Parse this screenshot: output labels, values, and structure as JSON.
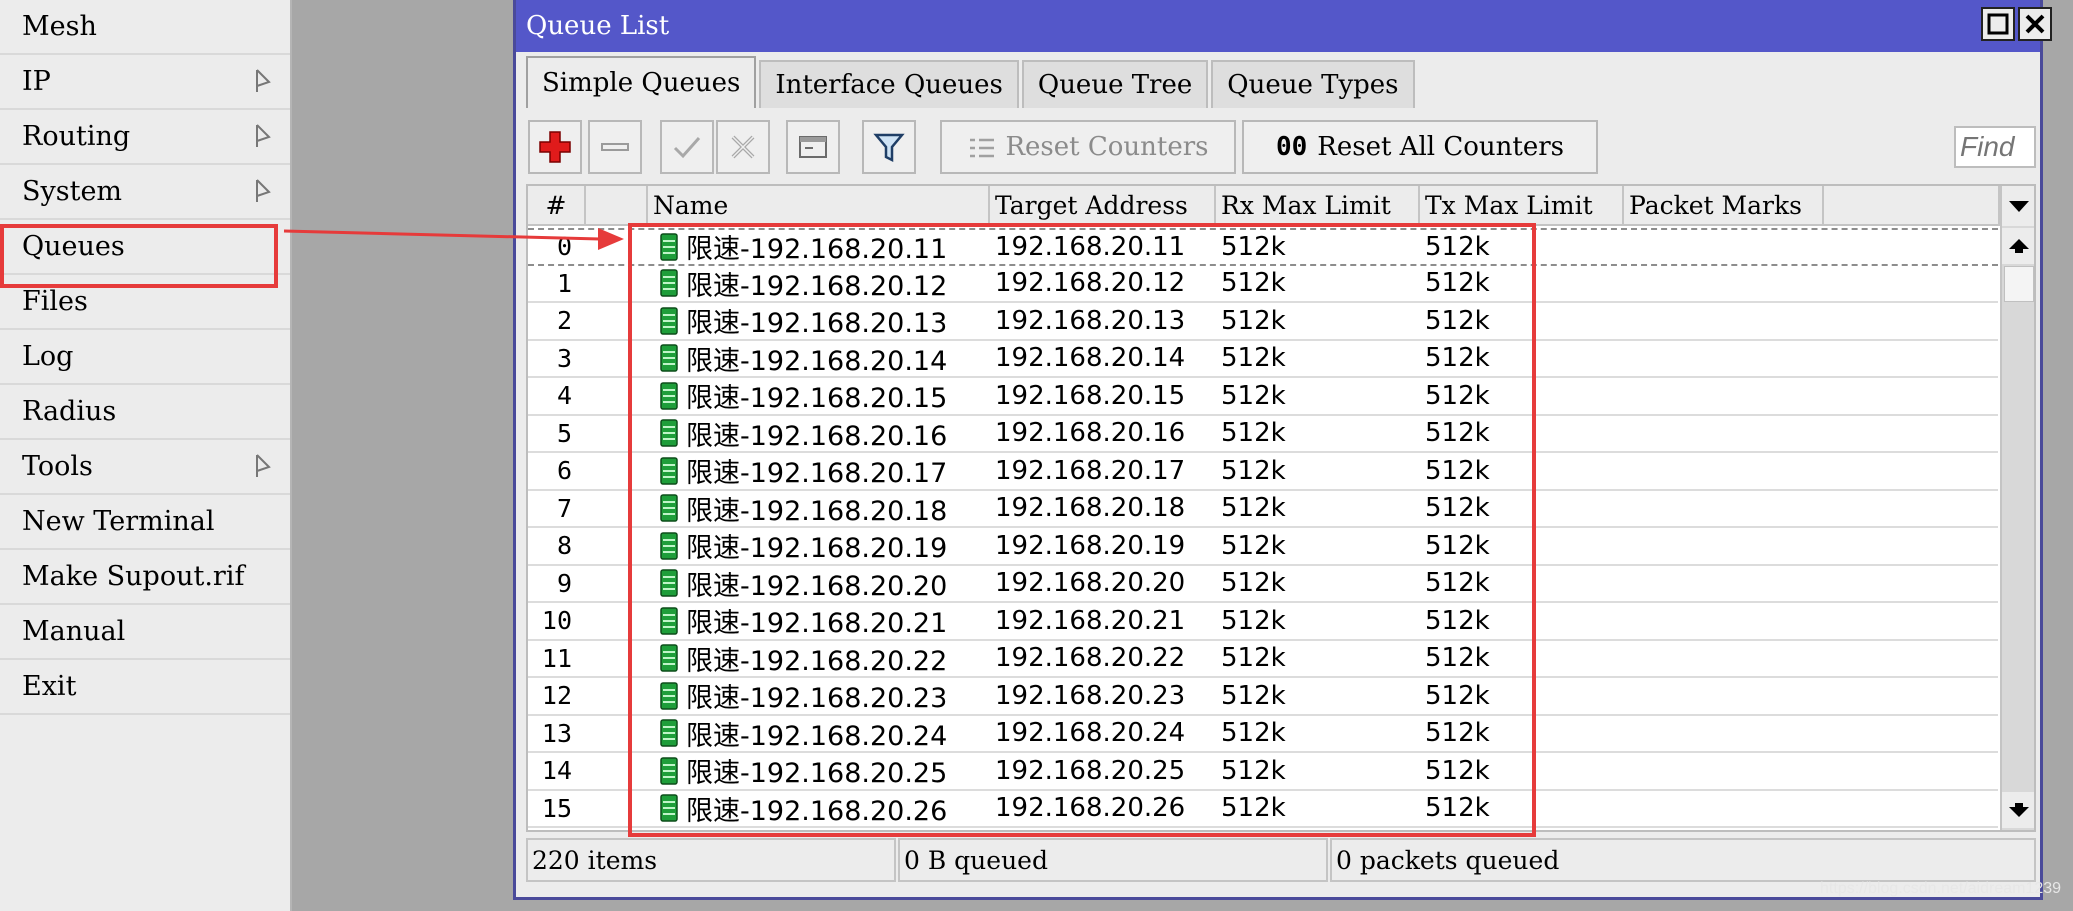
{
  "menu": {
    "items": [
      {
        "label": "Mesh",
        "submenu": false
      },
      {
        "label": "IP",
        "submenu": true
      },
      {
        "label": "Routing",
        "submenu": true
      },
      {
        "label": "System",
        "submenu": true
      },
      {
        "label": "Queues",
        "submenu": false
      },
      {
        "label": "Files",
        "submenu": false
      },
      {
        "label": "Log",
        "submenu": false
      },
      {
        "label": "Radius",
        "submenu": false
      },
      {
        "label": "Tools",
        "submenu": true
      },
      {
        "label": "New Terminal",
        "submenu": false
      },
      {
        "label": "Make Supout.rif",
        "submenu": false
      },
      {
        "label": "Manual",
        "submenu": false
      },
      {
        "label": "Exit",
        "submenu": false
      }
    ]
  },
  "window": {
    "title": "Queue List",
    "tabs": [
      {
        "label": "Simple Queues",
        "active": true
      },
      {
        "label": "Interface Queues",
        "active": false
      },
      {
        "label": "Queue Tree",
        "active": false
      },
      {
        "label": "Queue Types",
        "active": false
      }
    ],
    "toolbar": {
      "reset_counters": "Reset Counters",
      "reset_all_counters_prefix": "00",
      "reset_all_counters": "Reset All Counters",
      "find_placeholder": "Find"
    }
  },
  "table": {
    "columns": [
      "#",
      "",
      "Name",
      "Target Address",
      "Rx Max Limit",
      "Tx Max Limit",
      "Packet Marks"
    ],
    "rows": [
      {
        "num": "0",
        "name": "限速-192.168.20.11",
        "target": "192.168.20.11",
        "rx": "512k",
        "tx": "512k",
        "marks": ""
      },
      {
        "num": "1",
        "name": "限速-192.168.20.12",
        "target": "192.168.20.12",
        "rx": "512k",
        "tx": "512k",
        "marks": ""
      },
      {
        "num": "2",
        "name": "限速-192.168.20.13",
        "target": "192.168.20.13",
        "rx": "512k",
        "tx": "512k",
        "marks": ""
      },
      {
        "num": "3",
        "name": "限速-192.168.20.14",
        "target": "192.168.20.14",
        "rx": "512k",
        "tx": "512k",
        "marks": ""
      },
      {
        "num": "4",
        "name": "限速-192.168.20.15",
        "target": "192.168.20.15",
        "rx": "512k",
        "tx": "512k",
        "marks": ""
      },
      {
        "num": "5",
        "name": "限速-192.168.20.16",
        "target": "192.168.20.16",
        "rx": "512k",
        "tx": "512k",
        "marks": ""
      },
      {
        "num": "6",
        "name": "限速-192.168.20.17",
        "target": "192.168.20.17",
        "rx": "512k",
        "tx": "512k",
        "marks": ""
      },
      {
        "num": "7",
        "name": "限速-192.168.20.18",
        "target": "192.168.20.18",
        "rx": "512k",
        "tx": "512k",
        "marks": ""
      },
      {
        "num": "8",
        "name": "限速-192.168.20.19",
        "target": "192.168.20.19",
        "rx": "512k",
        "tx": "512k",
        "marks": ""
      },
      {
        "num": "9",
        "name": "限速-192.168.20.20",
        "target": "192.168.20.20",
        "rx": "512k",
        "tx": "512k",
        "marks": ""
      },
      {
        "num": "10",
        "name": "限速-192.168.20.21",
        "target": "192.168.20.21",
        "rx": "512k",
        "tx": "512k",
        "marks": ""
      },
      {
        "num": "11",
        "name": "限速-192.168.20.22",
        "target": "192.168.20.22",
        "rx": "512k",
        "tx": "512k",
        "marks": ""
      },
      {
        "num": "12",
        "name": "限速-192.168.20.23",
        "target": "192.168.20.23",
        "rx": "512k",
        "tx": "512k",
        "marks": ""
      },
      {
        "num": "13",
        "name": "限速-192.168.20.24",
        "target": "192.168.20.24",
        "rx": "512k",
        "tx": "512k",
        "marks": ""
      },
      {
        "num": "14",
        "name": "限速-192.168.20.25",
        "target": "192.168.20.25",
        "rx": "512k",
        "tx": "512k",
        "marks": ""
      },
      {
        "num": "15",
        "name": "限速-192.168.20.26",
        "target": "192.168.20.26",
        "rx": "512k",
        "tx": "512k",
        "marks": ""
      }
    ]
  },
  "status": {
    "items": "220 items",
    "bytes_queued": "0 B queued",
    "packets_queued": "0 packets queued"
  },
  "watermark": "https://blog.csdn.net/aidream1239",
  "colors": {
    "titlebar": "#5457c9",
    "highlight": "#e63b3b",
    "queue_icon": "#1e9e3a",
    "add_icon": "#e01b1b"
  }
}
